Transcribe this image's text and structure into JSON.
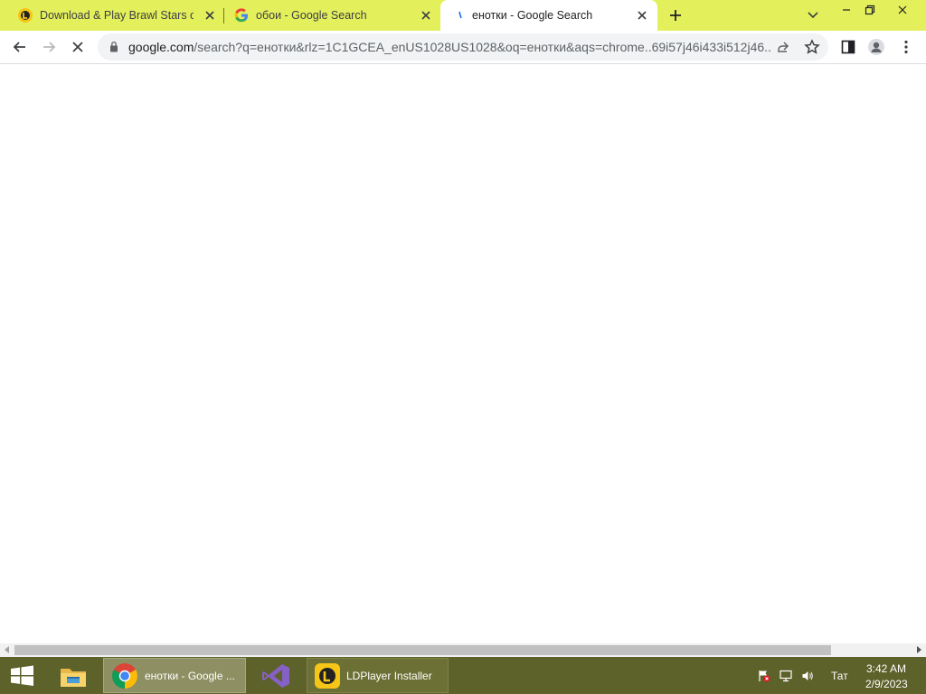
{
  "tabs": [
    {
      "title": "Download & Play Brawl Stars on",
      "favicon": "ldplayer-icon"
    },
    {
      "title": "обои - Google Search",
      "favicon": "google-g-icon"
    },
    {
      "title": "енотки - Google Search",
      "favicon": "loading-icon",
      "active": true
    }
  ],
  "omnibox": {
    "url_domain": "google.com",
    "url_path": "/search?q=енотки&rlz=1C1GCEA_enUS1028US1028&oq=енотки&aqs=chrome..69i57j46i433i512j46..."
  },
  "taskbar": {
    "items": [
      {
        "label": "",
        "icon": "file-explorer-icon"
      },
      {
        "label": "енотки - Google ...",
        "icon": "chrome-icon",
        "active": true
      },
      {
        "label": "",
        "icon": "visual-studio-icon"
      },
      {
        "label": "LDPlayer Installer",
        "icon": "ldplayer-icon"
      }
    ],
    "language": "Тат",
    "time": "3:42 AM",
    "date": "2/9/2023"
  },
  "colors": {
    "tabstrip": "#e4ef5c",
    "taskbar": "#5d612a",
    "active_task": "#8e9064"
  }
}
